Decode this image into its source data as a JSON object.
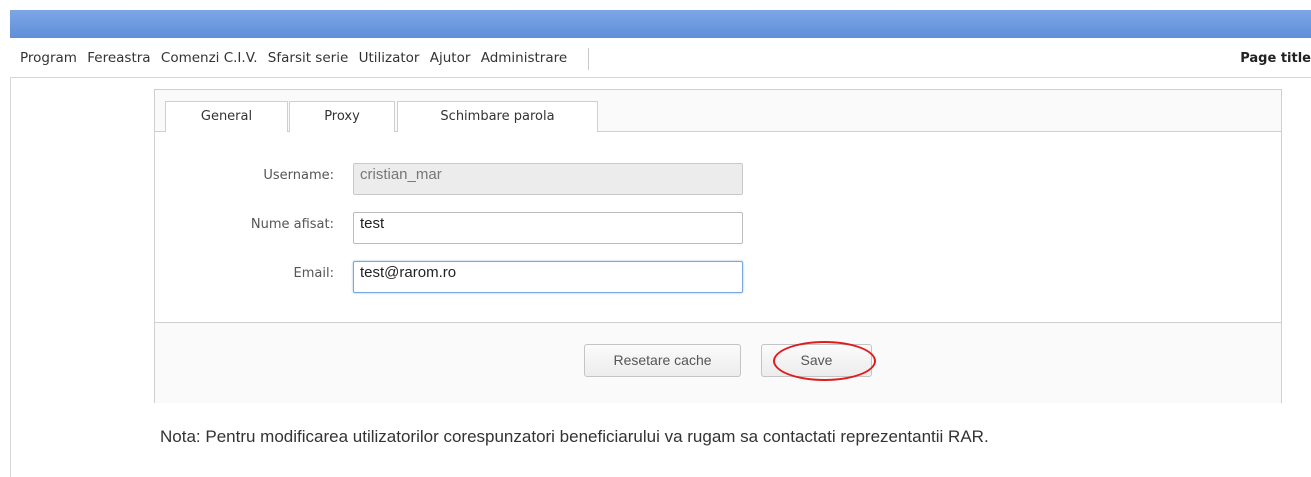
{
  "menu": {
    "items": [
      "Program",
      "Fereastra",
      "Comenzi C.I.V.",
      "Sfarsit serie",
      "Utilizator",
      "Ajutor",
      "Administrare"
    ],
    "page_title": "Page title"
  },
  "tabs": [
    {
      "label": "General",
      "active": true
    },
    {
      "label": "Proxy",
      "active": false
    },
    {
      "label": "Schimbare parola",
      "active": false
    }
  ],
  "form": {
    "username": {
      "label": "Username:",
      "value": "cristian_mar",
      "disabled": true
    },
    "display_name": {
      "label": "Nume afisat:",
      "value": "test"
    },
    "email": {
      "label": "Email:",
      "value": "test@rarom.ro",
      "focused": true
    }
  },
  "buttons": {
    "reset_cache": "Resetare cache",
    "save": "Save"
  },
  "note": "Nota: Pentru modificarea utilizatorilor corespunzatori beneficiarului va rugam sa contactati reprezentantii RAR.",
  "colors": {
    "titlebar": "#6a98df",
    "highlight": "#e01b1b"
  }
}
